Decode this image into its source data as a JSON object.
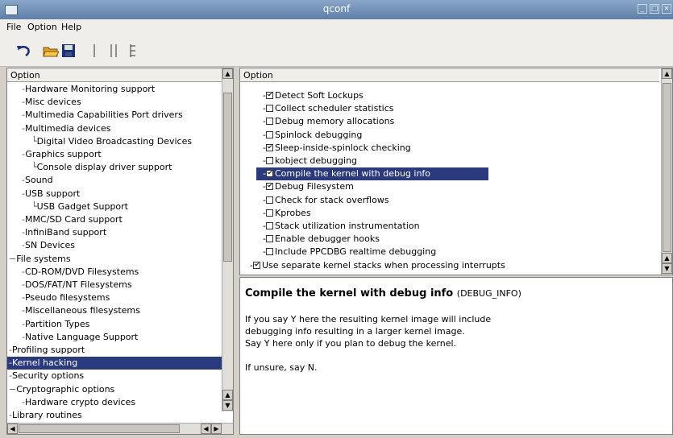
{
  "window": {
    "title": "qconf"
  },
  "menu": [
    "File",
    "Option",
    "Help"
  ],
  "menu_mnemonic": [
    "F",
    "O",
    "H"
  ],
  "toolbar": {
    "icons": [
      "undo-icon",
      "open-folder-icon",
      "save-disk-icon",
      "single-view-icon",
      "split-view-icon",
      "full-view-icon"
    ]
  },
  "left": {
    "header": "Option",
    "items": [
      {
        "label": "Hardware Monitoring support",
        "indent": 2
      },
      {
        "label": "Misc devices",
        "indent": 2
      },
      {
        "label": "Multimedia Capabilities Port drivers",
        "indent": 2
      },
      {
        "label": "Multimedia devices",
        "indent": 2
      },
      {
        "label": "Digital Video Broadcasting Devices",
        "indent": 3
      },
      {
        "label": "Graphics support",
        "indent": 2
      },
      {
        "label": "Console display driver support",
        "indent": 3
      },
      {
        "label": "Sound",
        "indent": 2
      },
      {
        "label": "USB support",
        "indent": 2
      },
      {
        "label": "USB Gadget Support",
        "indent": 3
      },
      {
        "label": "MMC/SD Card support",
        "indent": 2
      },
      {
        "label": "InfiniBand support",
        "indent": 2
      },
      {
        "label": "SN Devices",
        "indent": 2
      },
      {
        "label": "File systems",
        "indent": 1
      },
      {
        "label": "CD-ROM/DVD Filesystems",
        "indent": 2
      },
      {
        "label": "DOS/FAT/NT Filesystems",
        "indent": 2
      },
      {
        "label": "Pseudo filesystems",
        "indent": 2
      },
      {
        "label": "Miscellaneous filesystems",
        "indent": 2
      },
      {
        "label": "Partition Types",
        "indent": 2
      },
      {
        "label": "Native Language Support",
        "indent": 2
      },
      {
        "label": "Profiling support",
        "indent": 1
      },
      {
        "label": "Kernel hacking",
        "indent": 1,
        "selected": true
      },
      {
        "label": "Security options",
        "indent": 1
      },
      {
        "label": "Cryptographic options",
        "indent": 1
      },
      {
        "label": "Hardware crypto devices",
        "indent": 2
      },
      {
        "label": "Library routines",
        "indent": 1
      }
    ]
  },
  "options": {
    "header": "Option",
    "items": [
      {
        "label": "Detect Soft Lockups",
        "checked": true
      },
      {
        "label": "Collect scheduler statistics",
        "checked": false
      },
      {
        "label": "Debug memory allocations",
        "checked": false
      },
      {
        "label": "Spinlock debugging",
        "checked": false
      },
      {
        "label": "Sleep-inside-spinlock checking",
        "checked": true
      },
      {
        "label": "kobject debugging",
        "checked": false
      },
      {
        "label": "Compile the kernel with debug info",
        "checked": true,
        "selected": true
      },
      {
        "label": "Debug Filesystem",
        "checked": true
      },
      {
        "label": "Check for stack overflows",
        "checked": false
      },
      {
        "label": "Kprobes",
        "checked": false
      },
      {
        "label": "Stack utilization instrumentation",
        "checked": false
      },
      {
        "label": "Enable debugger hooks",
        "checked": false
      },
      {
        "label": "Include PPCDBG realtime debugging",
        "checked": false
      },
      {
        "label": "Use separate kernel stacks when processing interrupts",
        "checked": true,
        "outer": true
      }
    ]
  },
  "help": {
    "title": "Compile the kernel with debug info",
    "symbol": "(DEBUG_INFO)",
    "line1": "If you say Y here the resulting kernel image will include",
    "line2": "debugging info resulting in a larger kernel image.",
    "line3": "Say Y here only if you plan to debug the kernel.",
    "line4": "If unsure, say N."
  },
  "colors": {
    "selection": "#2b3a7d",
    "titlebar": "#6f8db4"
  }
}
